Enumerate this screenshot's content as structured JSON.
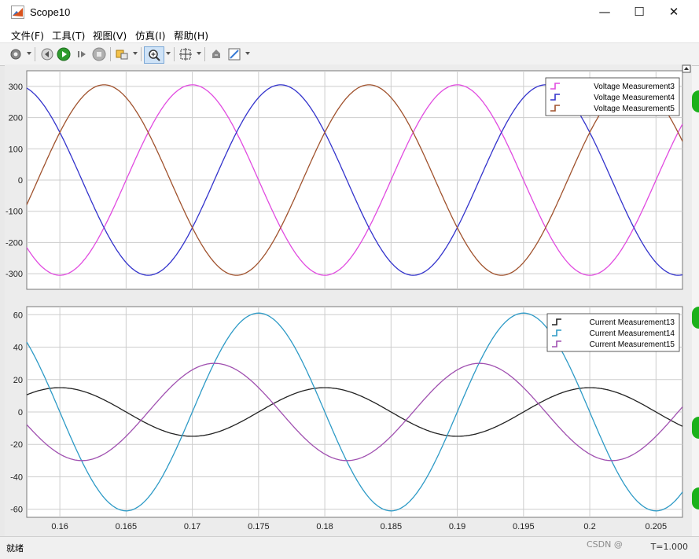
{
  "window": {
    "title": "Scope10",
    "minimize": "—",
    "maximize": "☐",
    "close": "✕"
  },
  "menu": [
    {
      "label": "文件(F)"
    },
    {
      "label": "工具(T)"
    },
    {
      "label": "视图(V)"
    },
    {
      "label": "仿真(I)"
    },
    {
      "label": "帮助(H)"
    }
  ],
  "toolbar": [
    "settings-icon",
    "step-back-icon",
    "run-icon",
    "step-forward-icon",
    "stop-icon",
    "highlight-icon",
    "zoom-icon",
    "autoscale-icon",
    "restore-icon",
    "style-icon"
  ],
  "status": {
    "left": "就绪",
    "right": "T=1.000",
    "watermark": "CSDN @"
  },
  "colors": {
    "magenta": "#e14be0",
    "blue": "#3333cc",
    "brown": "#a0522d",
    "black": "#222222",
    "cyan": "#2d9ac6",
    "purple": "#a050b0"
  },
  "chart_data": [
    {
      "type": "line",
      "xlim": [
        0.1575,
        0.207
      ],
      "ylim": [
        -350,
        350
      ],
      "yticks": [
        300,
        200,
        100,
        0,
        -100,
        -200,
        -300
      ],
      "grid": true,
      "legend_position": "top-right",
      "series": [
        {
          "name": "Voltage Measurement3",
          "amplitude": 305,
          "phase_deg": 180,
          "color": "#e14be0"
        },
        {
          "name": "Voltage Measurement4",
          "amplitude": 305,
          "phase_deg": 300,
          "color": "#3333cc"
        },
        {
          "name": "Voltage Measurement5",
          "amplitude": 305,
          "phase_deg": 60,
          "color": "#a0522d"
        }
      ],
      "frequency_hz": 50
    },
    {
      "type": "line",
      "xlim": [
        0.1575,
        0.207
      ],
      "ylim": [
        -65,
        65
      ],
      "xticks": [
        0.16,
        0.165,
        0.17,
        0.175,
        0.18,
        0.185,
        0.19,
        0.195,
        0.2,
        0.205
      ],
      "yticks": [
        60,
        40,
        20,
        0,
        -20,
        -40,
        -60
      ],
      "grid": true,
      "legend_position": "top-right",
      "series": [
        {
          "name": "Current Measurement13",
          "amplitude": 15,
          "phase_deg": 0,
          "color": "#222222"
        },
        {
          "name": "Current Measurement14",
          "amplitude": 61,
          "phase_deg": 270,
          "color": "#2d9ac6"
        },
        {
          "name": "Current Measurement15",
          "amplitude": 30,
          "phase_deg": 210,
          "color": "#a050b0"
        }
      ],
      "frequency_hz": 50
    }
  ]
}
